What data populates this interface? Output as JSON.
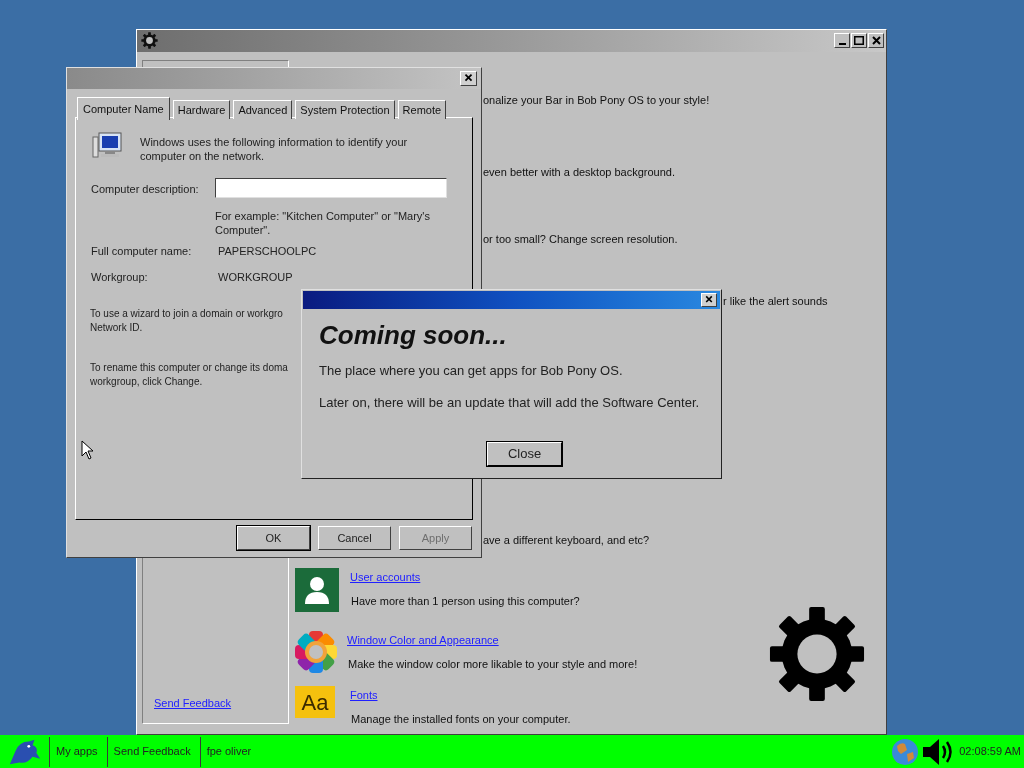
{
  "settings_window": {
    "partial_texts": [
      "onalize your Bar in Bob Pony OS to your style!",
      "even better with a desktop background.",
      "or too small? Change screen resolution.",
      "r like the alert sounds",
      "ave a different keyboard, and etc?"
    ],
    "items": [
      {
        "kind": "user",
        "link": "User accounts",
        "description": "Have more than 1 person using this computer?"
      },
      {
        "kind": "color",
        "link": "Window Color and Appearance",
        "description": "Make the window color more likable to your style and more!"
      },
      {
        "kind": "fonts",
        "icon_text": "Aa",
        "link": "Fonts",
        "description": "Manage the installed fonts on your computer."
      }
    ],
    "sidebar_link": "Send Feedback"
  },
  "system_properties": {
    "tabs": [
      {
        "label": "Computer Name",
        "selected": true
      },
      {
        "label": "Hardware",
        "selected": false
      },
      {
        "label": "Advanced",
        "selected": false
      },
      {
        "label": "System Protection",
        "selected": false
      },
      {
        "label": "Remote",
        "selected": false
      }
    ],
    "intro": "Windows uses the following information to identify your computer on the network.",
    "description_label": "Computer description:",
    "example": "For example: \"Kitchen Computer\" or \"Mary's Computer\".",
    "fields": [
      {
        "label": "Full computer name:",
        "value": "PAPERSCHOOLPC"
      },
      {
        "label": "Workgroup:",
        "value": "WORKGROUP"
      }
    ],
    "paragraphs": [
      [
        "To use a wizard to join a domain or workgro",
        "Network ID."
      ],
      [
        "To rename this computer or change its doma",
        "workgroup, click Change."
      ]
    ],
    "buttons": [
      {
        "label": "OK",
        "disabled": false
      },
      {
        "label": "Cancel",
        "disabled": false
      },
      {
        "label": "Apply",
        "disabled": true
      }
    ]
  },
  "message_box": {
    "heading": "Coming soon...",
    "lines": [
      "The place where you can get apps for Bob Pony OS.",
      "Later on, there will be an update that will add the Software Center."
    ],
    "button": "Close"
  },
  "taskbar": {
    "items": [
      "My apps",
      "Send Feedback",
      "fpe oliver"
    ],
    "clock": "02:08:59 AM"
  }
}
